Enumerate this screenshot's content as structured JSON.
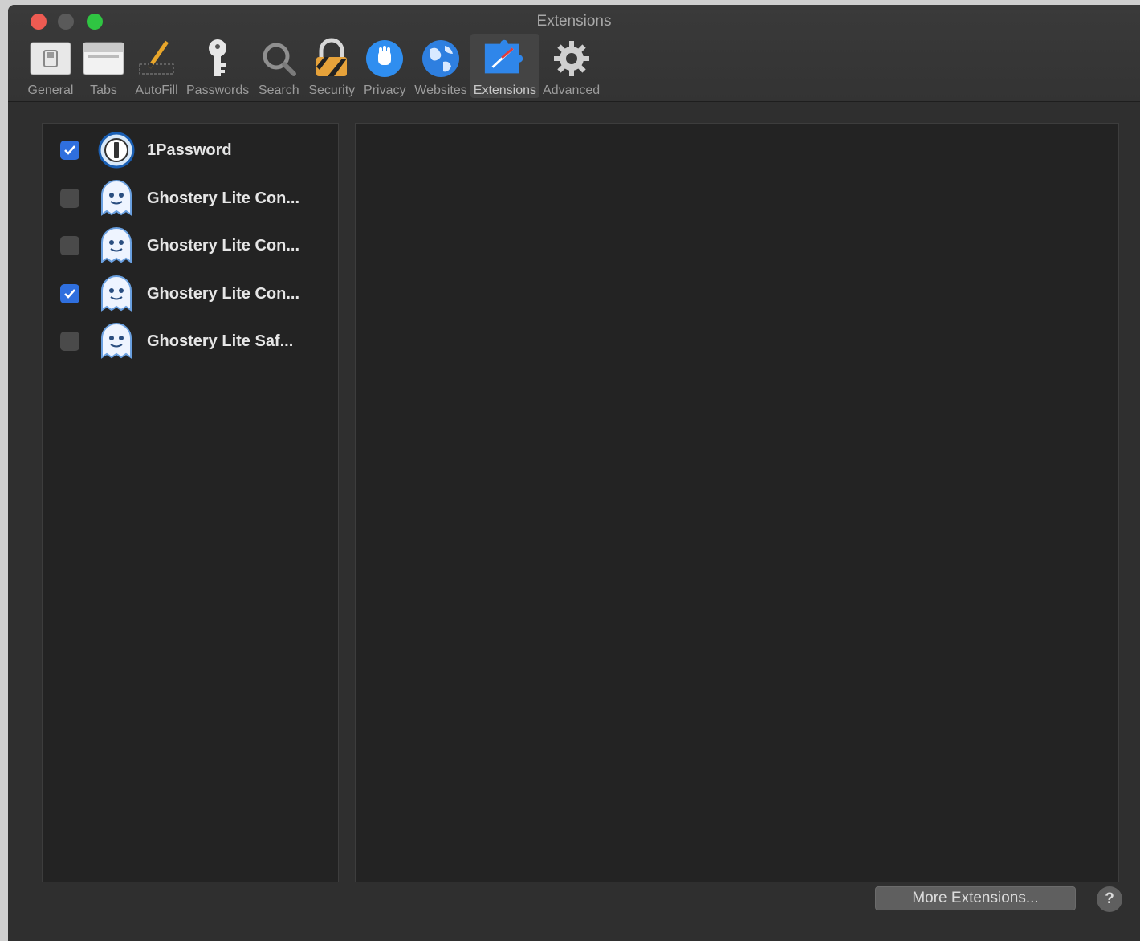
{
  "window": {
    "title": "Extensions"
  },
  "toolbar": {
    "items": [
      {
        "label": "General",
        "icon": "general-switch-icon"
      },
      {
        "label": "Tabs",
        "icon": "tabs-icon"
      },
      {
        "label": "AutoFill",
        "icon": "pencil-autofill-icon"
      },
      {
        "label": "Passwords",
        "icon": "key-icon"
      },
      {
        "label": "Search",
        "icon": "magnifier-icon"
      },
      {
        "label": "Security",
        "icon": "padlock-icon"
      },
      {
        "label": "Privacy",
        "icon": "hand-privacy-icon"
      },
      {
        "label": "Websites",
        "icon": "globe-icon"
      },
      {
        "label": "Extensions",
        "icon": "puzzle-extensions-icon",
        "selected": true
      },
      {
        "label": "Advanced",
        "icon": "gear-icon"
      }
    ]
  },
  "extensions": [
    {
      "name": "1Password",
      "enabled": true,
      "icon": "onepassword-icon"
    },
    {
      "name": "Ghostery Lite Con...",
      "enabled": false,
      "icon": "ghost-icon"
    },
    {
      "name": "Ghostery Lite Con...",
      "enabled": false,
      "icon": "ghost-icon"
    },
    {
      "name": "Ghostery Lite Con...",
      "enabled": true,
      "icon": "ghost-icon"
    },
    {
      "name": "Ghostery Lite Saf...",
      "enabled": false,
      "icon": "ghost-icon"
    }
  ],
  "footer": {
    "more_extensions_label": "More Extensions...",
    "help_label": "?"
  },
  "colors": {
    "window_bg": "#2d2d2d",
    "panel_bg": "#232323",
    "checkbox_checked": "#2f6fde",
    "close": "#ee5b52",
    "zoom": "#2fc542"
  }
}
